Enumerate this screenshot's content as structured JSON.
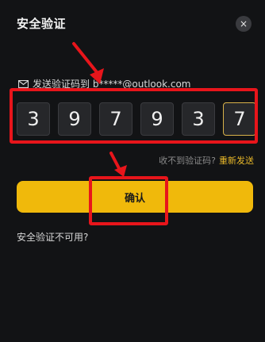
{
  "dialog": {
    "title": "安全验证",
    "close_icon": "×"
  },
  "email_notice": {
    "icon": "mail-icon",
    "text": "发送验证码到 b*****@outlook.com"
  },
  "code": {
    "digits": [
      "3",
      "9",
      "7",
      "9",
      "3",
      "7"
    ]
  },
  "resend": {
    "question": "收不到验证码?",
    "link": "重新发送"
  },
  "confirm_button": {
    "label": "确认"
  },
  "unavailable_link": {
    "label": "安全验证不可用?"
  },
  "colors": {
    "accent": "#f0b90b",
    "annotation": "#e8151b",
    "background": "#121315"
  }
}
